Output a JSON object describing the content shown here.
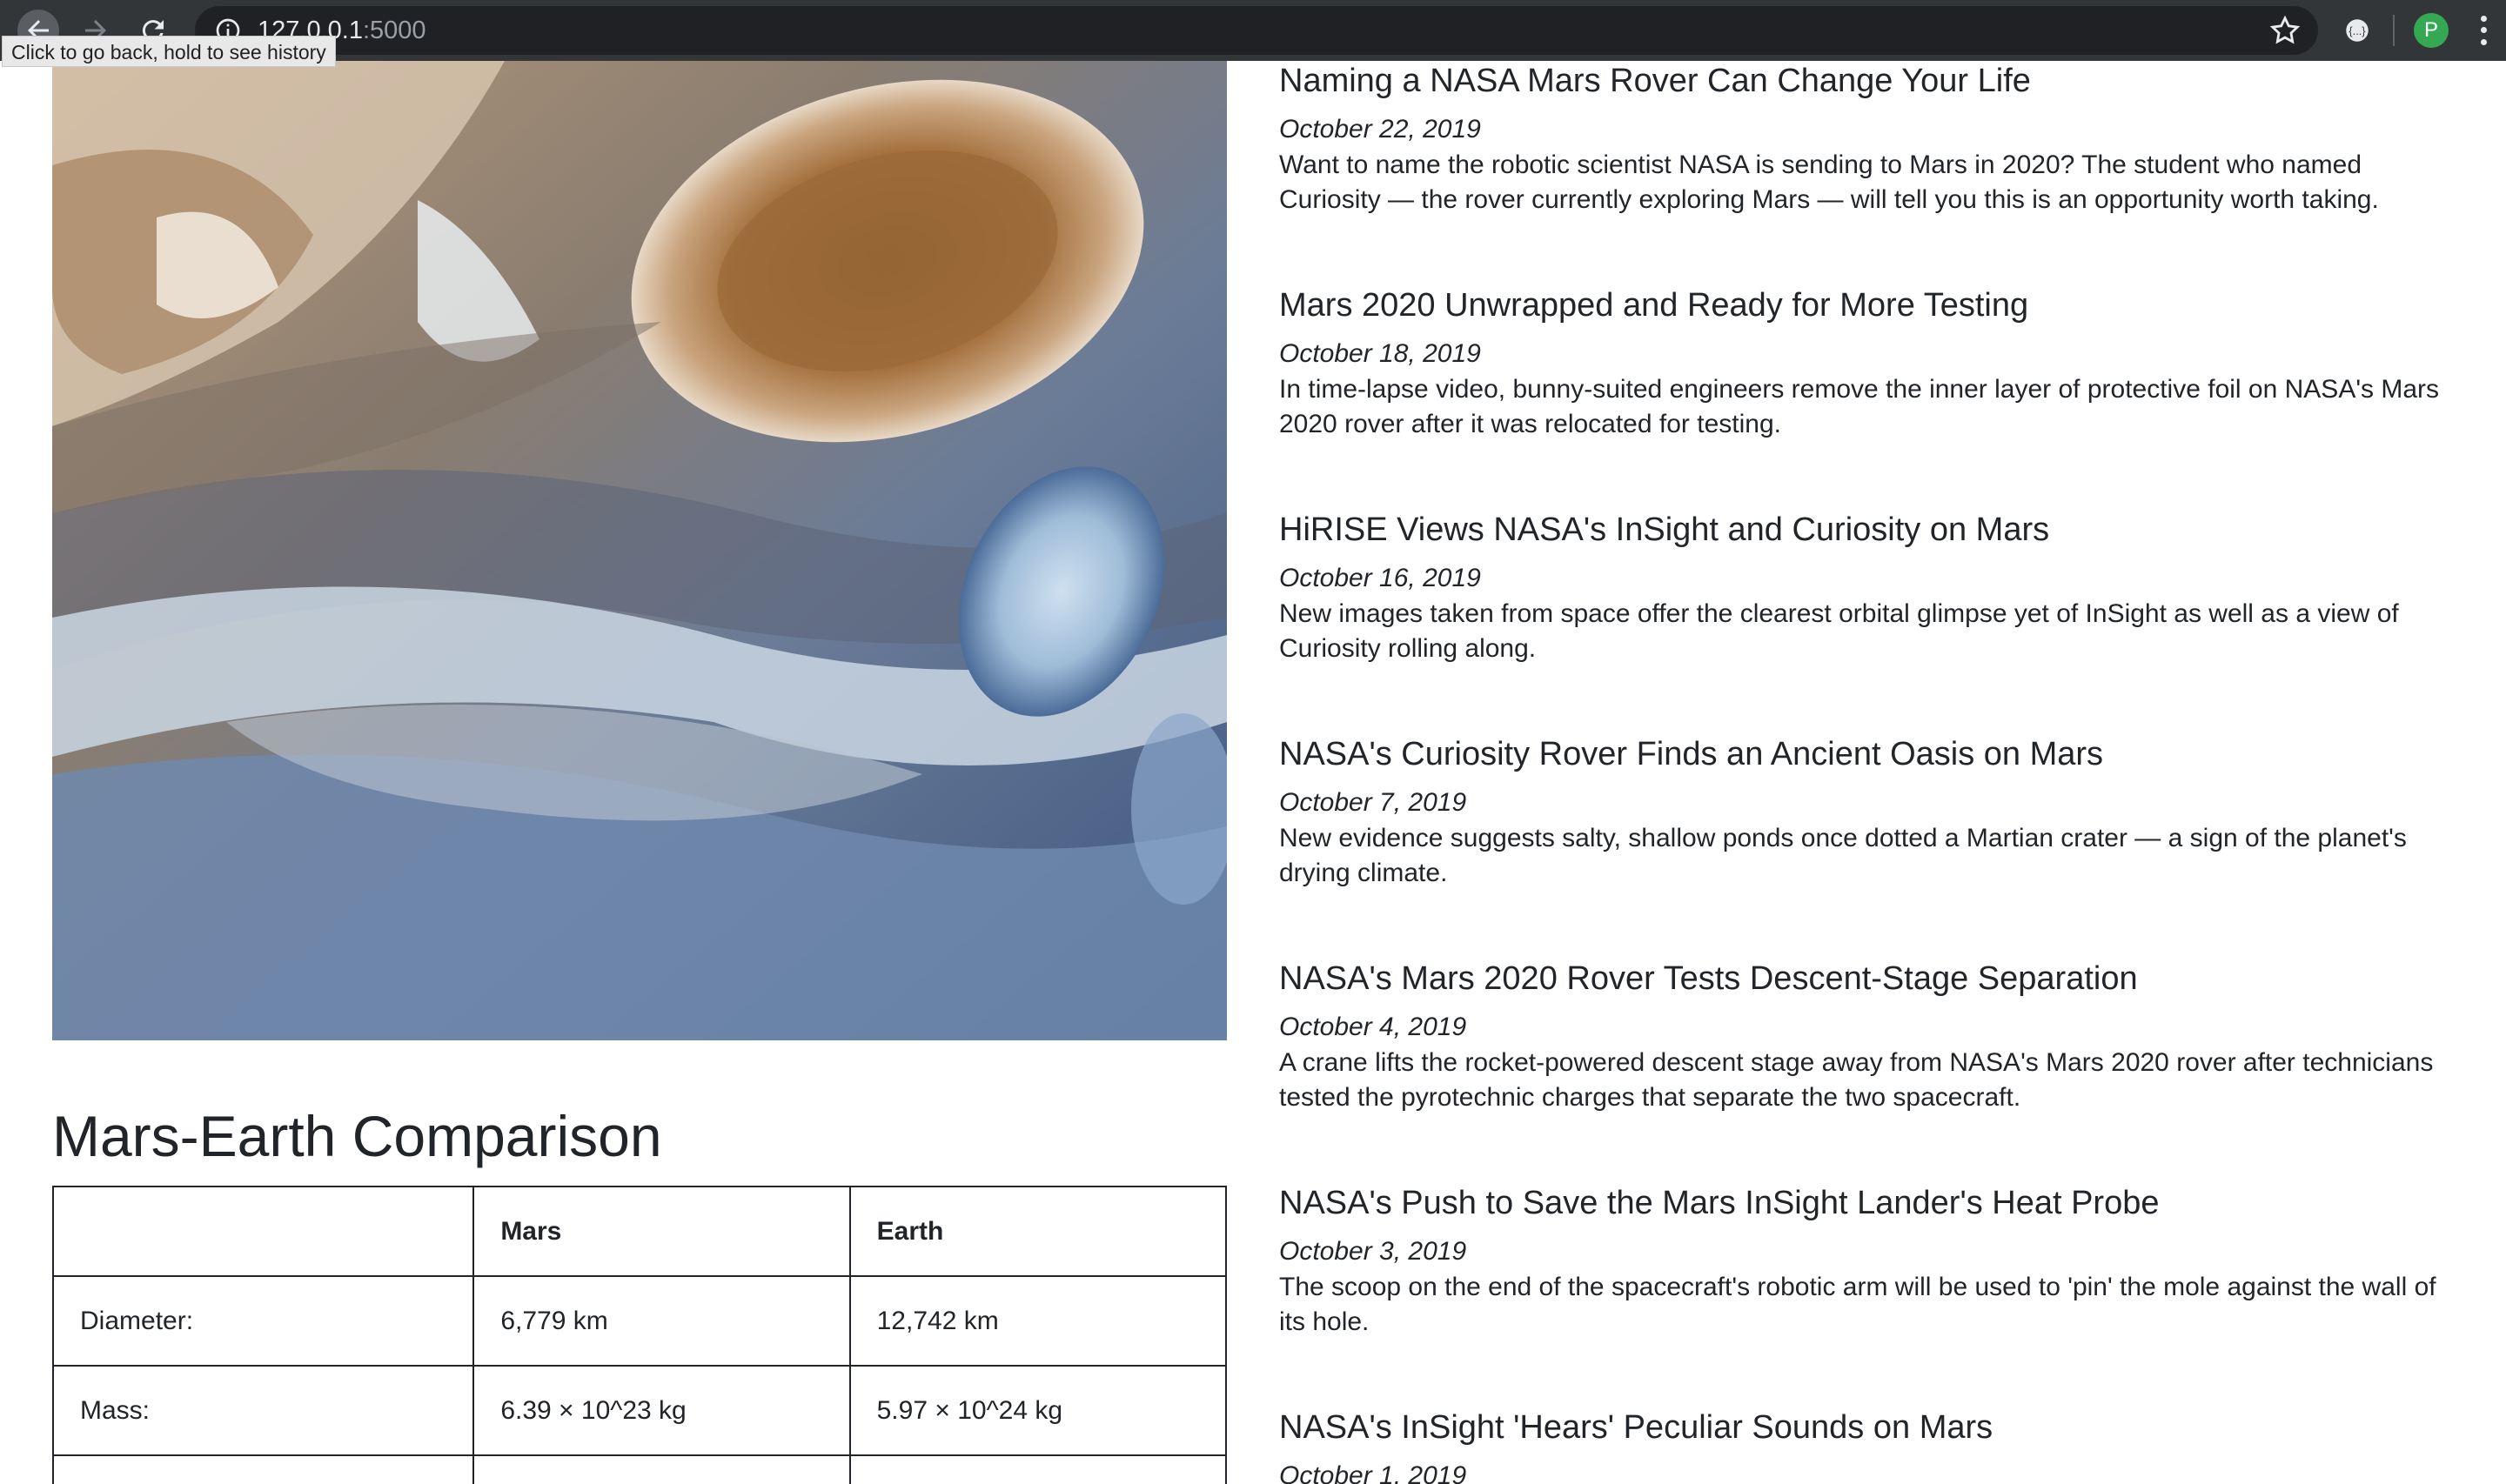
{
  "browser": {
    "url_host": "127.0.0.1",
    "url_port": ":5000",
    "tooltip": "Click to go back, hold to see history",
    "profile_initial": "P"
  },
  "comparison": {
    "title": "Mars-Earth Comparison",
    "headers": [
      "",
      "Mars",
      "Earth"
    ],
    "rows": [
      [
        "Diameter:",
        "6,779 km",
        "12,742 km"
      ],
      [
        "Mass:",
        "6.39 × 10^23 kg",
        "5.97 × 10^24 kg"
      ],
      [
        "",
        "",
        ""
      ]
    ]
  },
  "news": [
    {
      "title": "Naming a NASA Mars Rover Can Change Your Life",
      "date": "October 22, 2019",
      "teaser": "Want to name the robotic scientist NASA is sending to Mars in 2020? The student who named Curiosity — the rover currently exploring Mars — will tell you this is an opportunity worth taking."
    },
    {
      "title": "Mars 2020 Unwrapped and Ready for More Testing",
      "date": "October 18, 2019",
      "teaser": "In time-lapse video, bunny-suited engineers remove the inner layer of protective foil on NASA's Mars 2020 rover after it was relocated for testing."
    },
    {
      "title": "HiRISE Views NASA's InSight and Curiosity on Mars",
      "date": "October 16, 2019",
      "teaser": "New images taken from space offer the clearest orbital glimpse yet of InSight as well as a view of Curiosity rolling along."
    },
    {
      "title": "NASA's Curiosity Rover Finds an Ancient Oasis on Mars",
      "date": "October 7, 2019",
      "teaser": "New evidence suggests salty, shallow ponds once dotted a Martian crater — a sign of the planet's drying climate."
    },
    {
      "title": "NASA's Mars 2020 Rover Tests Descent-Stage Separation",
      "date": "October 4, 2019",
      "teaser": "A crane lifts the rocket-powered descent stage away from NASA's Mars 2020 rover after technicians tested the pyrotechnic charges that separate the two spacecraft."
    },
    {
      "title": "NASA's Push to Save the Mars InSight Lander's Heat Probe",
      "date": "October 3, 2019",
      "teaser": "The scoop on the end of the spacecraft's robotic arm will be used to 'pin' the mole against the wall of its hole."
    },
    {
      "title": "NASA's InSight 'Hears' Peculiar Sounds on Mars",
      "date": "October 1, 2019",
      "teaser": ""
    }
  ]
}
